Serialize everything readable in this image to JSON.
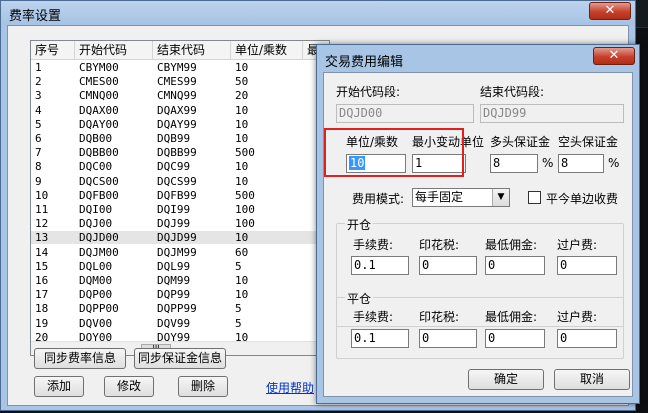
{
  "parent": {
    "title": "费率设置",
    "close_glyph": "✕",
    "columns": [
      "序号",
      "开始代码",
      "结束代码",
      "单位/乘数",
      "最"
    ],
    "rows": [
      [
        "1",
        "CBYM00",
        "CBYM99",
        "10"
      ],
      [
        "2",
        "CMES00",
        "CMES99",
        "50"
      ],
      [
        "3",
        "CMNQ00",
        "CMNQ99",
        "20"
      ],
      [
        "4",
        "DQAX00",
        "DQAX99",
        "10"
      ],
      [
        "5",
        "DQAY00",
        "DQAY99",
        "10"
      ],
      [
        "6",
        "DQB00",
        "DQB99",
        "10"
      ],
      [
        "7",
        "DQBB00",
        "DQBB99",
        "500"
      ],
      [
        "8",
        "DQC00",
        "DQC99",
        "10"
      ],
      [
        "9",
        "DQCS00",
        "DQCS99",
        "10"
      ],
      [
        "10",
        "DQFB00",
        "DQFB99",
        "500"
      ],
      [
        "11",
        "DQI00",
        "DQI99",
        "100"
      ],
      [
        "12",
        "DQJ00",
        "DQJ99",
        "100"
      ],
      [
        "13",
        "DQJD00",
        "DQJD99",
        "10"
      ],
      [
        "14",
        "DQJM00",
        "DQJM99",
        "60"
      ],
      [
        "15",
        "DQL00",
        "DQL99",
        "5"
      ],
      [
        "16",
        "DQM00",
        "DQM99",
        "10"
      ],
      [
        "17",
        "DQP00",
        "DQP99",
        "10"
      ],
      [
        "18",
        "DQPP00",
        "DQPP99",
        "5"
      ],
      [
        "19",
        "DQV00",
        "DQV99",
        "5"
      ],
      [
        "20",
        "DQY00",
        "DQY99",
        "10"
      ]
    ],
    "selected_row": 12,
    "scroll_thumb_glyph": "III",
    "buttons": {
      "sync_fee": "同步费率信息",
      "sync_margin": "同步保证金信息",
      "add": "添加",
      "edit": "修改",
      "delete": "删除"
    },
    "help_link": "使用帮助"
  },
  "dialog": {
    "title": "交易费用编辑",
    "close_glyph": "✕",
    "start_code_label": "开始代码段:",
    "start_code_value": "DQJD00",
    "end_code_label": "结束代码段:",
    "end_code_value": "DQJD99",
    "unit_label": "单位/乘数",
    "unit_value": "10",
    "min_tick_label": "最小变动单位",
    "min_tick_value": "1",
    "long_margin_label": "多头保证金",
    "long_margin_value": "8",
    "short_margin_label": "空头保证金",
    "short_margin_value": "8",
    "percent": "%",
    "fee_mode_label": "费用模式:",
    "fee_mode_value": "每手固定",
    "close_today_label": "平今单边收费",
    "open_group": {
      "title": "开仓",
      "fee_label": "手续费:",
      "stamp_label": "印花税:",
      "min_comm_label": "最低佣金:",
      "transfer_label": "过户费:",
      "fee_value": "0.1",
      "stamp_value": "0",
      "min_comm_value": "0",
      "transfer_value": "0"
    },
    "close_group": {
      "title": "平仓",
      "fee_label": "手续费:",
      "stamp_label": "印花税:",
      "min_comm_label": "最低佣金:",
      "transfer_label": "过户费:",
      "fee_value": "0.1",
      "stamp_value": "0",
      "min_comm_value": "0",
      "transfer_value": "0"
    },
    "ok_label": "确定",
    "cancel_label": "取消"
  },
  "colors": {
    "title_bar": "#a9c5e6",
    "close_button": "#c5412c",
    "highlight_box": "#e0201b",
    "selection": "#3399ff"
  }
}
